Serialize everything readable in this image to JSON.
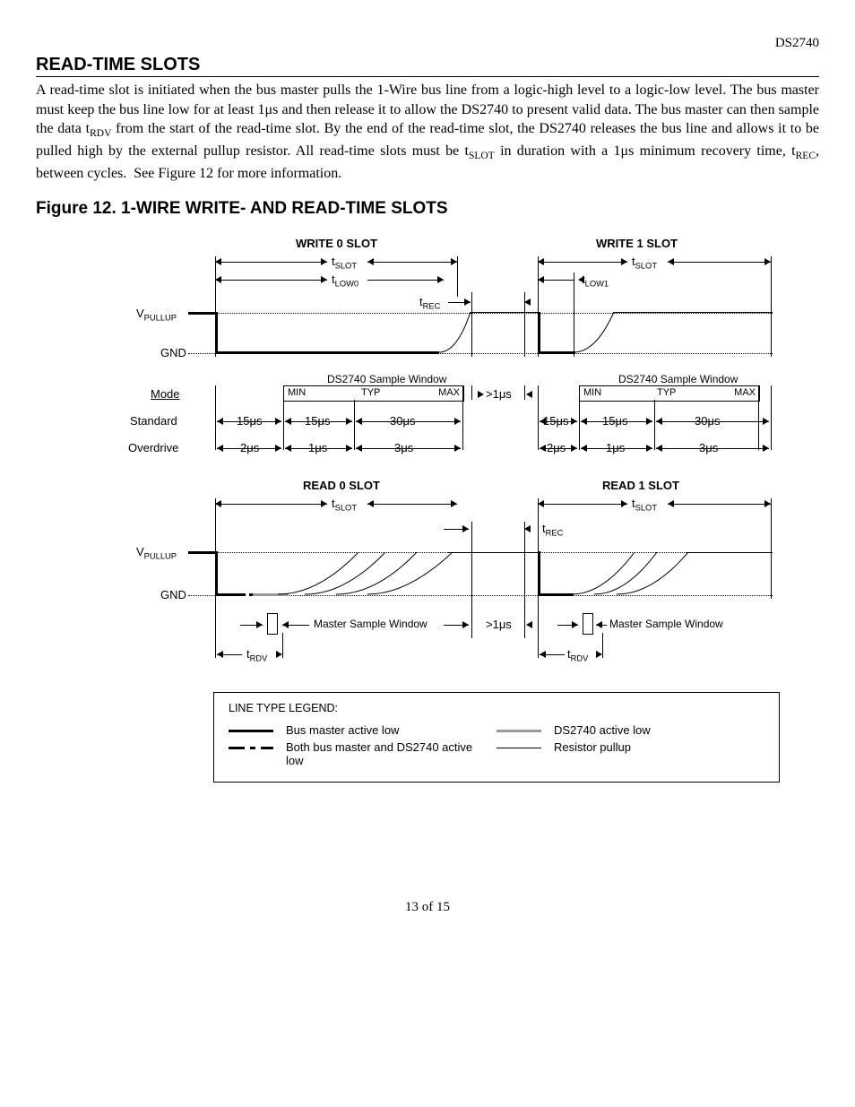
{
  "header": {
    "docid": "DS2740"
  },
  "section": {
    "title": "READ-TIME SLOTS"
  },
  "paragraph": {
    "text": "A read-time slot is initiated when the bus master pulls the 1-Wire bus line from a logic-high level to a logic-low level. The bus master must keep the bus line low for at least 1μs and then release it to allow the DS2740 to present valid data. The bus master can then sample the data tRDV from the start of the read-time slot. By the end of the read-time slot, the DS2740 releases the bus line and allows it to be pulled high by the external pullup resistor. All read-time slots must be tSLOT in duration with a 1μs minimum recovery time, tREC, between cycles.  See Figure 12 for more information."
  },
  "figure": {
    "title": "Figure 12. 1-WIRE WRITE- AND READ-TIME SLOTS"
  },
  "diagram": {
    "write0": "WRITE 0 SLOT",
    "write1": "WRITE 1 SLOT",
    "read0": "READ 0 SLOT",
    "read1": "READ 1 SLOT",
    "tSLOT": "tSLOT",
    "tLOW0": "tLOW0",
    "tLOW1": "tLOW1",
    "tREC": "tREC",
    "tRDV": "tRDV",
    "vpullup": "VPULLUP",
    "gnd": "GND",
    "mode": "Mode",
    "standard": "Standard",
    "overdrive": "Overdrive",
    "sampleWin": "DS2740 Sample Window",
    "masterWin": "Master Sample Window",
    "min": "MIN",
    "typ": "TYP",
    "max": "MAX",
    "gt1us": ">1μs",
    "t15": "15μs",
    "t30": "30μs",
    "t2": "2μs",
    "t1": "1μs",
    "t3": "3μs"
  },
  "legend": {
    "title": "LINE TYPE LEGEND:",
    "busmaster": "Bus master active low",
    "both": "Both bus master and DS2740 active low",
    "ds2740": "DS2740 active low",
    "resistor": "Resistor pullup"
  },
  "footer": {
    "page": "13 of 15"
  }
}
